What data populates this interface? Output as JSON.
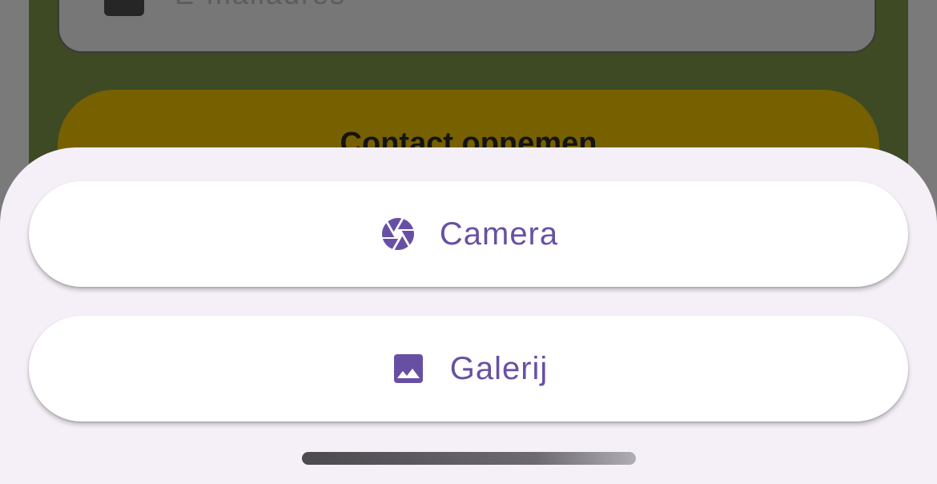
{
  "background_page": {
    "email_field": {
      "placeholder": "E-mailadres",
      "icon": "keyboard-icon"
    },
    "contact_button": {
      "label": "Contact opnemen"
    }
  },
  "bottom_sheet": {
    "options": [
      {
        "label": "Camera",
        "icon": "camera-shutter-icon"
      },
      {
        "label": "Galerij",
        "icon": "image-icon"
      }
    ]
  },
  "colors": {
    "accent": "#6750a4",
    "sheet_background": "#f5eff7",
    "contact_button": "#776000",
    "background_panel": "#3d4a24"
  }
}
